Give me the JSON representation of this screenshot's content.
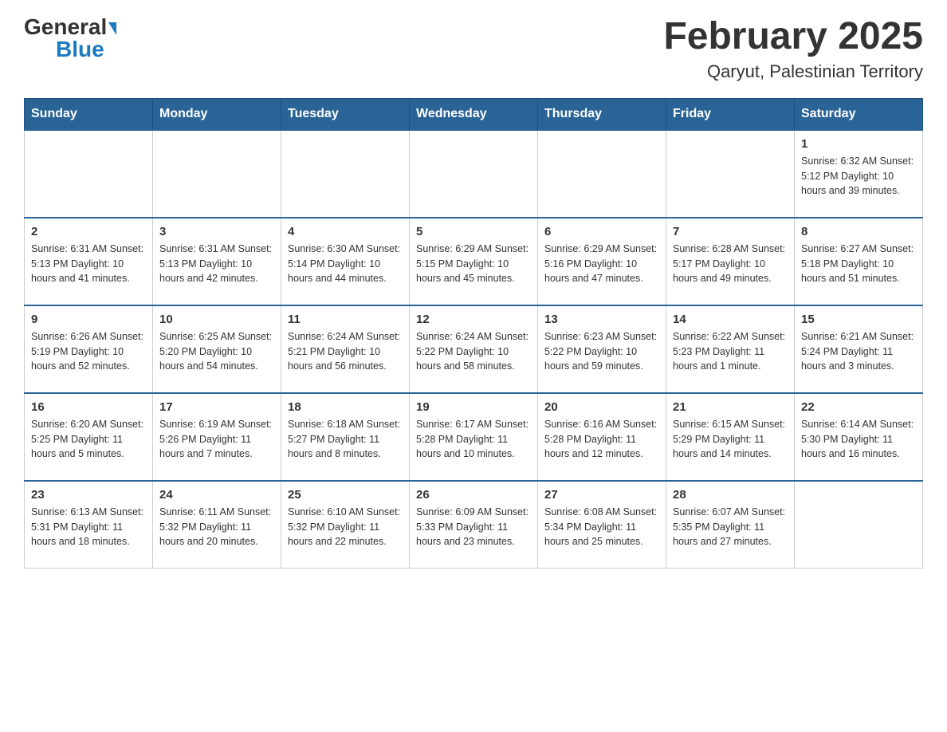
{
  "header": {
    "logo_general": "General",
    "logo_blue": "Blue",
    "title": "February 2025",
    "subtitle": "Qaryut, Palestinian Territory"
  },
  "weekdays": [
    "Sunday",
    "Monday",
    "Tuesday",
    "Wednesday",
    "Thursday",
    "Friday",
    "Saturday"
  ],
  "weeks": [
    [
      {
        "day": "",
        "info": ""
      },
      {
        "day": "",
        "info": ""
      },
      {
        "day": "",
        "info": ""
      },
      {
        "day": "",
        "info": ""
      },
      {
        "day": "",
        "info": ""
      },
      {
        "day": "",
        "info": ""
      },
      {
        "day": "1",
        "info": "Sunrise: 6:32 AM\nSunset: 5:12 PM\nDaylight: 10 hours and 39 minutes."
      }
    ],
    [
      {
        "day": "2",
        "info": "Sunrise: 6:31 AM\nSunset: 5:13 PM\nDaylight: 10 hours and 41 minutes."
      },
      {
        "day": "3",
        "info": "Sunrise: 6:31 AM\nSunset: 5:13 PM\nDaylight: 10 hours and 42 minutes."
      },
      {
        "day": "4",
        "info": "Sunrise: 6:30 AM\nSunset: 5:14 PM\nDaylight: 10 hours and 44 minutes."
      },
      {
        "day": "5",
        "info": "Sunrise: 6:29 AM\nSunset: 5:15 PM\nDaylight: 10 hours and 45 minutes."
      },
      {
        "day": "6",
        "info": "Sunrise: 6:29 AM\nSunset: 5:16 PM\nDaylight: 10 hours and 47 minutes."
      },
      {
        "day": "7",
        "info": "Sunrise: 6:28 AM\nSunset: 5:17 PM\nDaylight: 10 hours and 49 minutes."
      },
      {
        "day": "8",
        "info": "Sunrise: 6:27 AM\nSunset: 5:18 PM\nDaylight: 10 hours and 51 minutes."
      }
    ],
    [
      {
        "day": "9",
        "info": "Sunrise: 6:26 AM\nSunset: 5:19 PM\nDaylight: 10 hours and 52 minutes."
      },
      {
        "day": "10",
        "info": "Sunrise: 6:25 AM\nSunset: 5:20 PM\nDaylight: 10 hours and 54 minutes."
      },
      {
        "day": "11",
        "info": "Sunrise: 6:24 AM\nSunset: 5:21 PM\nDaylight: 10 hours and 56 minutes."
      },
      {
        "day": "12",
        "info": "Sunrise: 6:24 AM\nSunset: 5:22 PM\nDaylight: 10 hours and 58 minutes."
      },
      {
        "day": "13",
        "info": "Sunrise: 6:23 AM\nSunset: 5:22 PM\nDaylight: 10 hours and 59 minutes."
      },
      {
        "day": "14",
        "info": "Sunrise: 6:22 AM\nSunset: 5:23 PM\nDaylight: 11 hours and 1 minute."
      },
      {
        "day": "15",
        "info": "Sunrise: 6:21 AM\nSunset: 5:24 PM\nDaylight: 11 hours and 3 minutes."
      }
    ],
    [
      {
        "day": "16",
        "info": "Sunrise: 6:20 AM\nSunset: 5:25 PM\nDaylight: 11 hours and 5 minutes."
      },
      {
        "day": "17",
        "info": "Sunrise: 6:19 AM\nSunset: 5:26 PM\nDaylight: 11 hours and 7 minutes."
      },
      {
        "day": "18",
        "info": "Sunrise: 6:18 AM\nSunset: 5:27 PM\nDaylight: 11 hours and 8 minutes."
      },
      {
        "day": "19",
        "info": "Sunrise: 6:17 AM\nSunset: 5:28 PM\nDaylight: 11 hours and 10 minutes."
      },
      {
        "day": "20",
        "info": "Sunrise: 6:16 AM\nSunset: 5:28 PM\nDaylight: 11 hours and 12 minutes."
      },
      {
        "day": "21",
        "info": "Sunrise: 6:15 AM\nSunset: 5:29 PM\nDaylight: 11 hours and 14 minutes."
      },
      {
        "day": "22",
        "info": "Sunrise: 6:14 AM\nSunset: 5:30 PM\nDaylight: 11 hours and 16 minutes."
      }
    ],
    [
      {
        "day": "23",
        "info": "Sunrise: 6:13 AM\nSunset: 5:31 PM\nDaylight: 11 hours and 18 minutes."
      },
      {
        "day": "24",
        "info": "Sunrise: 6:11 AM\nSunset: 5:32 PM\nDaylight: 11 hours and 20 minutes."
      },
      {
        "day": "25",
        "info": "Sunrise: 6:10 AM\nSunset: 5:32 PM\nDaylight: 11 hours and 22 minutes."
      },
      {
        "day": "26",
        "info": "Sunrise: 6:09 AM\nSunset: 5:33 PM\nDaylight: 11 hours and 23 minutes."
      },
      {
        "day": "27",
        "info": "Sunrise: 6:08 AM\nSunset: 5:34 PM\nDaylight: 11 hours and 25 minutes."
      },
      {
        "day": "28",
        "info": "Sunrise: 6:07 AM\nSunset: 5:35 PM\nDaylight: 11 hours and 27 minutes."
      },
      {
        "day": "",
        "info": ""
      }
    ]
  ]
}
